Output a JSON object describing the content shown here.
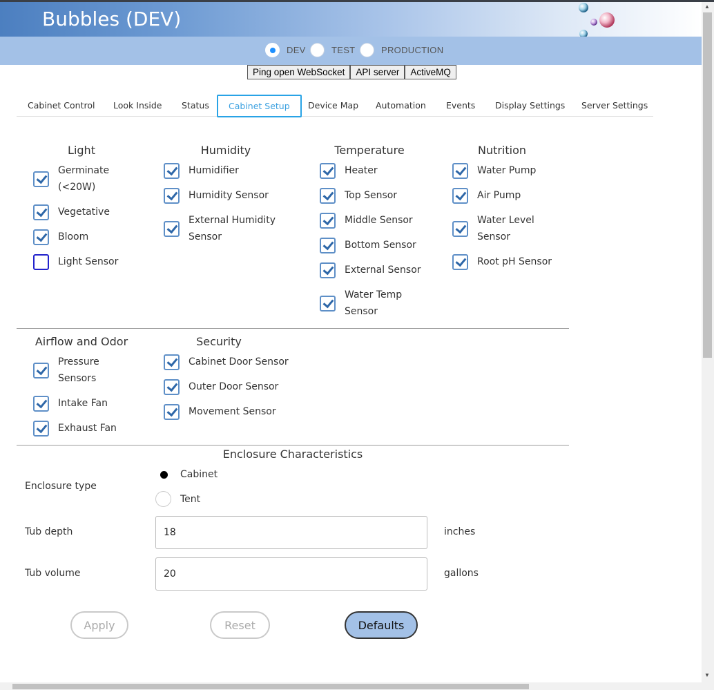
{
  "app": {
    "title": "Bubbles (DEV)"
  },
  "environments": [
    {
      "label": "DEV",
      "selected": true
    },
    {
      "label": "TEST",
      "selected": false
    },
    {
      "label": "PRODUCTION",
      "selected": false
    }
  ],
  "utility_buttons": [
    "Ping open WebSocket",
    "API server",
    "ActiveMQ"
  ],
  "tabs": [
    {
      "label": "Cabinet Control",
      "active": false
    },
    {
      "label": "Look Inside",
      "active": false
    },
    {
      "label": "Status",
      "active": false
    },
    {
      "label": "Cabinet Setup",
      "active": true
    },
    {
      "label": "Device Map",
      "active": false
    },
    {
      "label": "Automation",
      "active": false
    },
    {
      "label": "Events",
      "active": false
    },
    {
      "label": "Display Settings",
      "active": false
    },
    {
      "label": "Server Settings",
      "active": false
    }
  ],
  "groups": {
    "light": {
      "title": "Light",
      "items": [
        {
          "label": "Germinate (<20W)",
          "checked": true
        },
        {
          "label": "Vegetative",
          "checked": true
        },
        {
          "label": "Bloom",
          "checked": true
        },
        {
          "label": "Light Sensor",
          "checked": false
        }
      ]
    },
    "humidity": {
      "title": "Humidity",
      "items": [
        {
          "label": "Humidifier",
          "checked": true
        },
        {
          "label": "Humidity Sensor",
          "checked": true
        },
        {
          "label": "External Humidity Sensor",
          "checked": true
        }
      ]
    },
    "temperature": {
      "title": "Temperature",
      "items": [
        {
          "label": "Heater",
          "checked": true
        },
        {
          "label": "Top Sensor",
          "checked": true
        },
        {
          "label": "Middle Sensor",
          "checked": true
        },
        {
          "label": "Bottom Sensor",
          "checked": true
        },
        {
          "label": "External Sensor",
          "checked": true
        },
        {
          "label": "Water Temp Sensor",
          "checked": true
        }
      ]
    },
    "nutrition": {
      "title": "Nutrition",
      "items": [
        {
          "label": "Water Pump",
          "checked": true
        },
        {
          "label": "Air Pump",
          "checked": true
        },
        {
          "label": "Water Level Sensor",
          "checked": true
        },
        {
          "label": "Root pH Sensor",
          "checked": true
        }
      ]
    },
    "airflow": {
      "title": "Airflow and Odor",
      "items": [
        {
          "label": "Pressure Sensors",
          "checked": true
        },
        {
          "label": "Intake Fan",
          "checked": true
        },
        {
          "label": "Exhaust Fan",
          "checked": true
        }
      ]
    },
    "security": {
      "title": "Security",
      "items": [
        {
          "label": "Cabinet Door Sensor",
          "checked": true
        },
        {
          "label": "Outer Door Sensor",
          "checked": true
        },
        {
          "label": "Movement Sensor",
          "checked": true
        }
      ]
    }
  },
  "enclosure": {
    "title": "Enclosure Characteristics",
    "type_label": "Enclosure type",
    "type_options": [
      {
        "label": "Cabinet",
        "selected": true
      },
      {
        "label": "Tent",
        "selected": false
      }
    ],
    "tub_depth_label": "Tub depth",
    "tub_depth_value": "18",
    "tub_depth_unit": "inches",
    "tub_volume_label": "Tub volume",
    "tub_volume_value": "20",
    "tub_volume_unit": "gallons"
  },
  "actions": {
    "apply_label": "Apply",
    "reset_label": "Reset",
    "defaults_label": "Defaults"
  },
  "colors": {
    "header_start": "#4c7fc0",
    "env_bar": "#a3c1e7",
    "tab_active": "#29a3e6",
    "checkbox": "#2e67a8"
  }
}
